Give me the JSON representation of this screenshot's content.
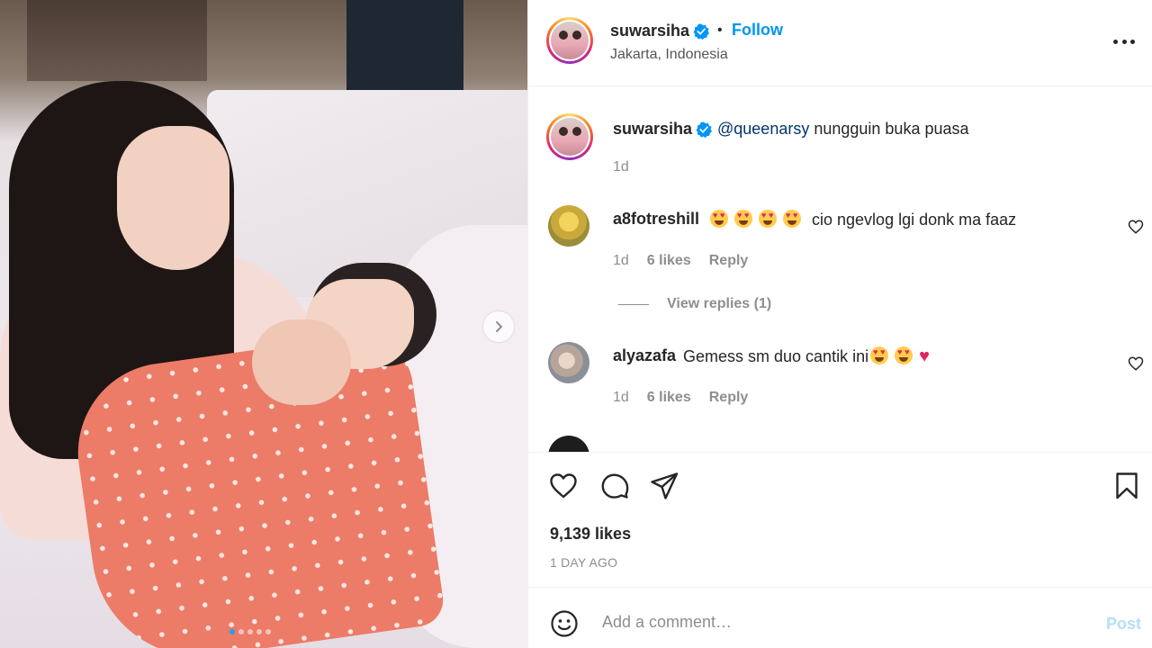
{
  "post": {
    "image_alt_icon": "next-arrow-icon",
    "carousel": {
      "slides": 5,
      "active_index": 0
    }
  },
  "header": {
    "username": "suwarsiha",
    "separator": "•",
    "follow_label": "Follow",
    "location": "Jakarta, Indonesia",
    "more_icon": "more-options-icon"
  },
  "caption": {
    "username": "suwarsiha",
    "mention": "@queenarsy",
    "text": " nungguin buka puasa",
    "time": "1d"
  },
  "comments": [
    {
      "username": "a8fotreshill",
      "text": "cio ngevlog lgi donk ma faaz",
      "time": "1d",
      "likes": "6 likes",
      "reply_label": "Reply",
      "view_replies": "View replies (1)"
    },
    {
      "username": "alyazafa",
      "text": "Gemess sm duo cantik ini",
      "time": "1d",
      "likes": "6 likes",
      "reply_label": "Reply"
    }
  ],
  "actions": {
    "like_icon": "heart-icon",
    "comment_icon": "comment-icon",
    "share_icon": "share-icon",
    "save_icon": "bookmark-icon"
  },
  "stats": {
    "likes": "9,139 likes",
    "time_ago": "1 DAY AGO"
  },
  "comment_box": {
    "placeholder": "Add a comment…",
    "post_label": "Post"
  },
  "colors": {
    "link_blue": "#0095f6",
    "mention_blue": "#00376b",
    "muted": "#8e8e8e",
    "post_disabled": "#b2dffc"
  }
}
